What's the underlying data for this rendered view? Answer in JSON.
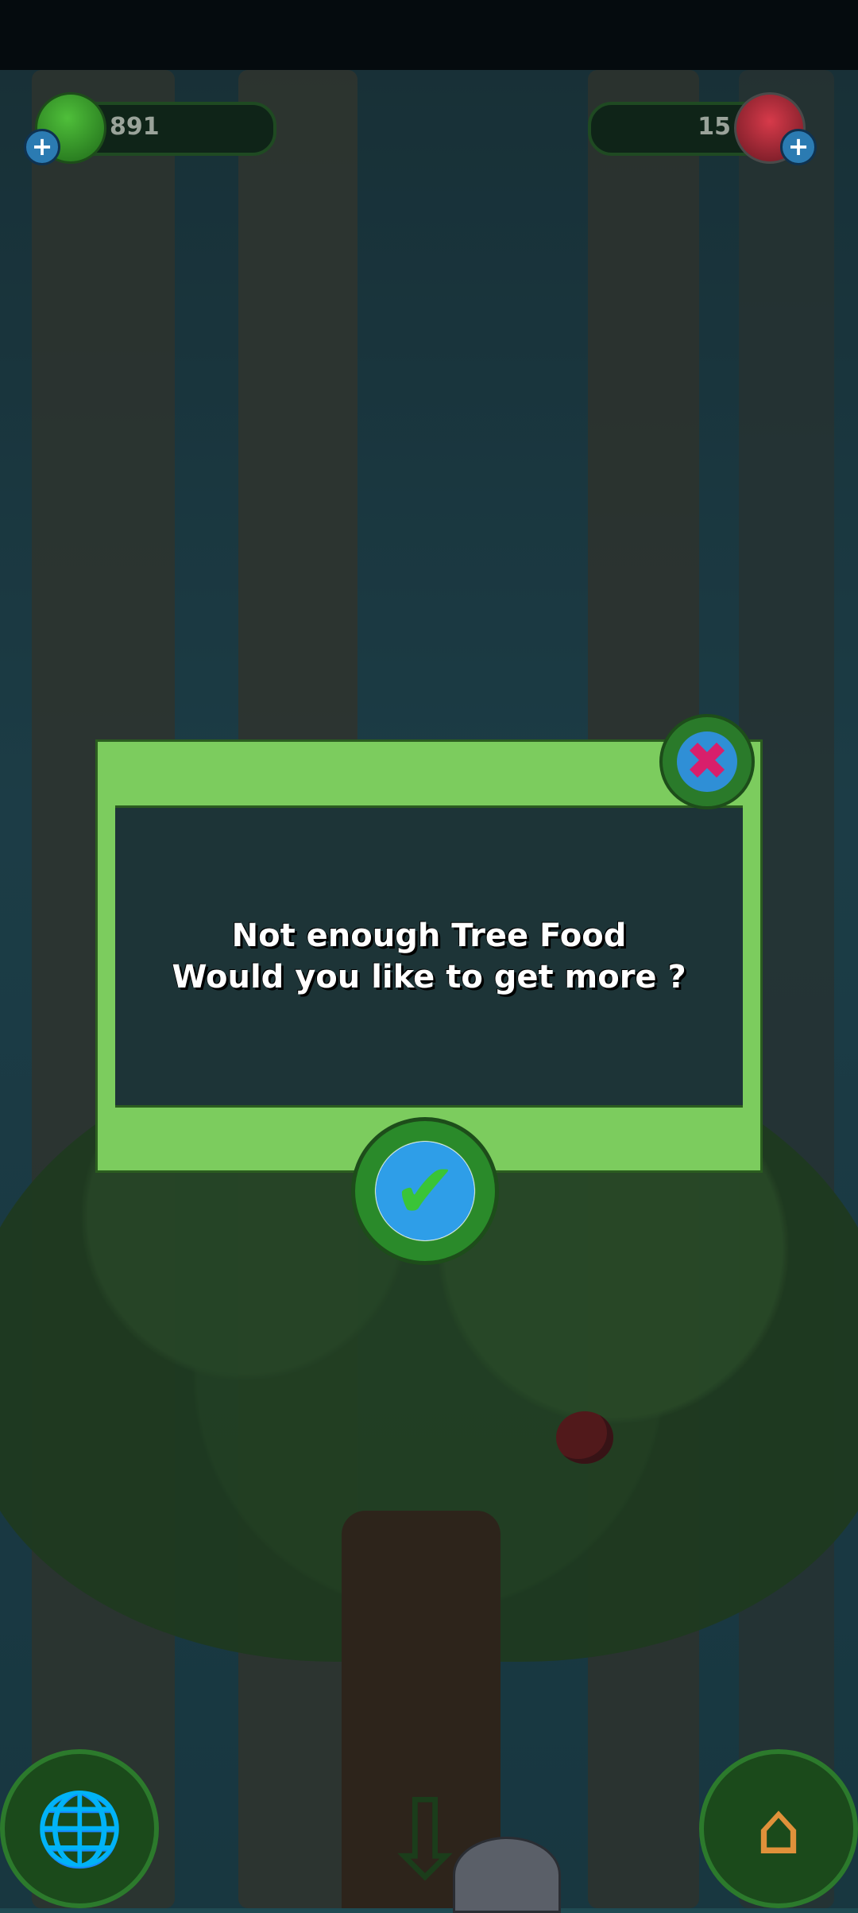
{
  "status_bar": {},
  "resources": {
    "left": {
      "value": "891",
      "icon": "green-gem-icon",
      "add_icon": "plus-icon"
    },
    "right": {
      "value": "15",
      "icon": "red-crystal-icon",
      "add_icon": "plus-icon"
    }
  },
  "dialog": {
    "line1": "Not enough Tree Food",
    "line2": "Would you like to get more ?",
    "close_symbol": "✖",
    "confirm_symbol": "✔"
  },
  "bottom_nav": {
    "left_icon": "globe-icon",
    "left_symbol": "🌐",
    "center_icon": "down-arrow-icon",
    "center_symbol": "⇩",
    "right_icon": "birdhouse-icon",
    "right_symbol": "⌂"
  },
  "colors": {
    "dialog_frame": "#7ccc5e",
    "dialog_body": "#1d3437",
    "close_accent": "#d81f6b",
    "confirm_accent": "#3ac437"
  }
}
